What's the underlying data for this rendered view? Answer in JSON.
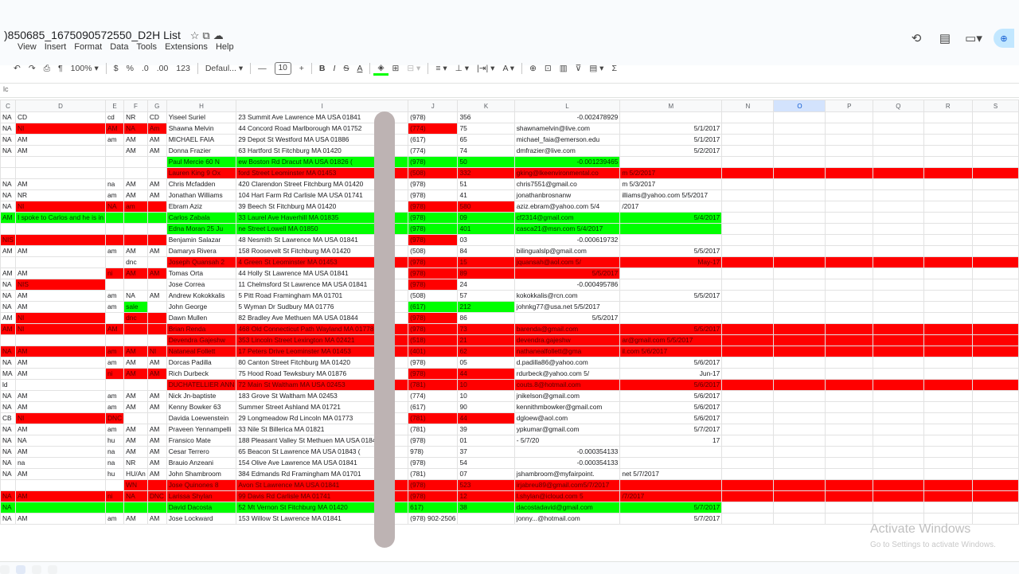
{
  "app": {
    "doc_title": ")850685_1675090572550_D2H List",
    "menu": [
      "View",
      "Insert",
      "Format",
      "Data",
      "Tools",
      "Extensions",
      "Help"
    ]
  },
  "toolbar": {
    "zoom": "100%",
    "currency": "$",
    "percent": "%",
    "dec_decrease": ".0",
    "dec_increase": ".00",
    "format_123": "123",
    "font": "Defaul...",
    "font_size": "10",
    "minus": "—",
    "plus": "+",
    "bold": "B",
    "italic": "I",
    "strike": "S",
    "text_color": "A",
    "sigma": "Σ"
  },
  "formula_bar": {
    "cell_ref": "lc"
  },
  "columns": [
    "C",
    "D",
    "E",
    "F",
    "G",
    "H",
    "I",
    "J",
    "K",
    "L",
    "M",
    "N",
    "O",
    "P",
    "Q",
    "R",
    "S"
  ],
  "selected_column": "O",
  "rows": [
    {
      "style": "",
      "cells": [
        "NA",
        "CD",
        "cd",
        "NR",
        "CD",
        "Yiseel Suriel",
        "23 Summit Ave Lawrence MA USA 01841",
        "(978)",
        "356",
        "-0.002478929",
        "",
        "",
        "",
        "",
        "",
        "",
        ""
      ],
      "num": [
        9
      ],
      "marks": {}
    },
    {
      "style": "",
      "cells": [
        "NA",
        "NI",
        "AM",
        "NA",
        "Am",
        "Shawna Melvin",
        "44 Concord Road Marlborough MA 01752",
        "(774)",
        "75",
        "shawnamelvin@live.com",
        "5/1/2017",
        "",
        "",
        "",
        "",
        "",
        ""
      ],
      "num": [
        10
      ],
      "marks": {
        "1": "r",
        "2": "r",
        "3": "r",
        "4": "r",
        "7": "r"
      }
    },
    {
      "style": "",
      "cells": [
        "NA",
        "AM",
        "am",
        "AM",
        "AM",
        "MICHAEL FAIA",
        "29 Depot St Westford MA USA 01886",
        "(617)",
        "65",
        "michael_faia@emerson.edu",
        "5/1/2017",
        "",
        "",
        "",
        "",
        "",
        ""
      ],
      "num": [
        10
      ],
      "marks": {}
    },
    {
      "style": "",
      "cells": [
        "NA",
        "AM",
        "",
        "AM",
        "AM",
        "Donna Frazier",
        "63 Hartford St Fitchburg MA 01420",
        "(774)",
        "74",
        "dmfrazier@live.com",
        "5/2/2017",
        "",
        "",
        "",
        "",
        "",
        ""
      ],
      "num": [
        10
      ],
      "marks": {}
    },
    {
      "style": "green",
      "cells": [
        "",
        "",
        "",
        "",
        "",
        "Paul Mercie 60 N",
        "ew Boston Rd Dracut MA USA 01826 (",
        "(978)",
        "50",
        "-0.001239465",
        "",
        "",
        "",
        "",
        "",
        "",
        ""
      ],
      "num": [
        9
      ],
      "marks": {},
      "span": [
        5,
        10
      ]
    },
    {
      "style": "red",
      "cells": [
        "",
        "",
        "",
        "",
        "",
        "Lauren King 9 Ox",
        "ford Street Leominster MA 01453",
        "(508)",
        "332",
        "gking@lkeenvironmental.co",
        "m 5/2/2017",
        "",
        "",
        "",
        "",
        "",
        ""
      ],
      "num": [],
      "marks": {},
      "span": [
        5,
        17
      ]
    },
    {
      "style": "",
      "cells": [
        "NA",
        "AM",
        "na",
        "AM",
        "AM",
        "Chris Mcfadden",
        "420 Clarendon Street Fitchburg MA 01420",
        "(978)",
        "51",
        "chris7551@gmail.co",
        "m 5/3/2017",
        "",
        "",
        "",
        "",
        "",
        ""
      ],
      "num": [],
      "marks": {}
    },
    {
      "style": "",
      "cells": [
        "NA",
        "NR",
        "am",
        "AM",
        "AM",
        "Jonathan Williams",
        "104 Hart Farm Rd Carlisle MA USA 01741",
        "(978)",
        "41",
        "jonathanbrosnanw",
        "illiams@yahoo.com 5/5/2017",
        "",
        "",
        "",
        "",
        "",
        ""
      ],
      "num": [],
      "marks": {}
    },
    {
      "style": "",
      "cells": [
        "NA",
        "NI",
        "NA",
        "am",
        "",
        "Ebram Aziz",
        "39 Beech St Fitchburg MA 01420",
        "(978)",
        "580",
        "aziz.ebram@yahoo.com 5/4",
        "/2017",
        "",
        "",
        "",
        "",
        "",
        ""
      ],
      "num": [],
      "marks": {
        "1": "r",
        "2": "r",
        "3": "r",
        "4": "r",
        "7": "r",
        "8": "r"
      }
    },
    {
      "style": "green",
      "cells": [
        "AM",
        "I spoke to Carlos and he is in",
        "",
        "",
        "",
        "Carlos Zabala",
        "33 Laurel Ave Haverhill MA 01835",
        "(978)",
        "09",
        "cf2314@gmail.com",
        "5/4/2017",
        "",
        "",
        "",
        "",
        "",
        ""
      ],
      "num": [
        10
      ],
      "marks": {},
      "span": [
        0,
        11
      ]
    },
    {
      "style": "green",
      "cells": [
        "",
        "",
        "",
        "",
        "",
        "Edna Moran 25 Ju",
        "ne Street Lowell MA 01850",
        "(978)",
        "401",
        "casca21@msn.com 5/4/2017",
        "",
        "",
        "",
        "",
        "",
        "",
        ""
      ],
      "num": [],
      "marks": {},
      "span": [
        5,
        11
      ]
    },
    {
      "style": "",
      "cells": [
        "NIS",
        "",
        "",
        "",
        "",
        "Benjamin Salazar",
        "48 Nesmith St Lawrence MA USA 01841",
        "(978)",
        "03",
        "-0.000619732",
        "",
        "",
        "",
        "",
        "",
        "",
        ""
      ],
      "num": [
        9
      ],
      "marks": {
        "0": "r",
        "1": "r",
        "2": "r",
        "3": "r",
        "4": "r",
        "7": "r"
      }
    },
    {
      "style": "",
      "cells": [
        "AM",
        "AM",
        "am",
        "AM",
        "AM",
        "Damarys Rivera",
        "158 Roosevelt St Fitchburg MA 01420",
        "(508)",
        "84",
        "bilingualslp@gmail.com",
        "5/5/2017",
        "",
        "",
        "",
        "",
        "",
        ""
      ],
      "num": [
        10
      ],
      "marks": {}
    },
    {
      "style": "red",
      "cells": [
        "",
        "",
        "",
        "dnc",
        "",
        "Joseph Quansah 2",
        "4 Green St Leominster MA 01453",
        "(978)",
        "15",
        "jquansah@aol.com 5/",
        "May-17",
        "",
        "",
        "",
        "",
        "",
        ""
      ],
      "num": [
        10
      ],
      "marks": {
        "0": "w",
        "1": "w",
        "2": "w",
        "3": "w",
        "4": "w"
      },
      "span": [
        5,
        17
      ]
    },
    {
      "style": "",
      "cells": [
        "AM",
        "AM",
        "ni",
        "AM",
        "AM",
        "Tomas Orta",
        "44 Holly St Lawrence MA USA 01841",
        "(978)",
        "89",
        "5/5/2017",
        "",
        "",
        "",
        "",
        "",
        "",
        ""
      ],
      "num": [
        9
      ],
      "marks": {
        "2": "r",
        "3": "r",
        "4": "r",
        "7": "r",
        "8": "r",
        "9": "r"
      }
    },
    {
      "style": "",
      "cells": [
        "NA",
        "NIS",
        "",
        "",
        "",
        "Jose Correa",
        "11 Chelmsford St Lawrence MA USA 01841",
        "(978)",
        "24",
        "-0.000495786",
        "",
        "",
        "",
        "",
        "",
        "",
        ""
      ],
      "num": [
        9
      ],
      "marks": {
        "1": "r",
        "7": "r"
      }
    },
    {
      "style": "",
      "cells": [
        "NA",
        "AM",
        "am",
        "NA",
        "AM",
        "Andrew Kokokkalis",
        "5 Pitt Road Framingham MA 01701",
        "(508)",
        "57",
        "kokokkalis@rcn.com",
        "5/5/2017",
        "",
        "",
        "",
        "",
        "",
        ""
      ],
      "num": [
        10
      ],
      "marks": {}
    },
    {
      "style": "",
      "cells": [
        "NA",
        "AM",
        "am",
        "sale",
        "",
        "John George",
        "5 Wyman Dr Sudbury MA 01776",
        "(617)",
        "212",
        "johnkg77@usa.net 5/5/2017",
        "",
        "",
        "",
        "",
        "",
        "",
        ""
      ],
      "num": [],
      "marks": {
        "3": "g",
        "7": "g",
        "8": "g"
      }
    },
    {
      "style": "",
      "cells": [
        "AM",
        "NI",
        "",
        "dnc",
        "",
        "Dawn Mullen",
        "82 Bradley Ave Methuen MA USA 01844",
        "(978)",
        "86",
        "5/5/2017",
        "",
        "",
        "",
        "",
        "",
        "",
        ""
      ],
      "num": [
        9
      ],
      "marks": {
        "1": "r",
        "3": "r",
        "4": "r",
        "7": "r"
      }
    },
    {
      "style": "red",
      "cells": [
        "AM",
        "NI",
        "AM",
        "",
        "",
        "Brian Renda",
        "468 Old Connecticut Path Wayland MA 01778",
        "(978)",
        "73",
        "barenda@gmail.com",
        "5/5/2017",
        "",
        "",
        "",
        "",
        "",
        ""
      ],
      "num": [
        10
      ],
      "marks": {},
      "span": [
        0,
        17
      ]
    },
    {
      "style": "red",
      "cells": [
        "",
        "",
        "",
        "",
        "",
        "Devendra Gajeshw",
        "353 Lincoln Street Lexington MA 02421",
        "(518)",
        "21",
        "devendra.gajeshw",
        "ar@gmail.com 5/5/2017",
        "",
        "",
        "",
        "",
        "",
        ""
      ],
      "num": [],
      "marks": {},
      "span": [
        5,
        17
      ]
    },
    {
      "style": "red",
      "cells": [
        "NA",
        "AM",
        "am",
        "AM",
        "NI",
        "Nataneal Follett",
        "17 Peters Drive Leominster MA 01453",
        "(401)",
        "62",
        "nathanealfollett@gma",
        "il.com 5/6/2017",
        "",
        "",
        "",
        "",
        "",
        ""
      ],
      "num": [],
      "marks": {},
      "span": [
        0,
        17
      ]
    },
    {
      "style": "",
      "cells": [
        "NA",
        "AM",
        "am",
        "AM",
        "AM",
        "Dorcas Padilla",
        "80 Canton Street Fitchburg MA 01420",
        "(978)",
        "05",
        "d.padilla86@yahoo.com",
        "5/6/2017",
        "",
        "",
        "",
        "",
        "",
        ""
      ],
      "num": [
        10
      ],
      "marks": {}
    },
    {
      "style": "",
      "cells": [
        "MA",
        "AM",
        "ni",
        "AM",
        "AM",
        "Rich Durbeck",
        "75 Hood Road Tewksbury MA 01876",
        "(978)",
        "44",
        "rdurbeck@yahoo.com 5/",
        "Jun-17",
        "",
        "",
        "",
        "",
        "",
        ""
      ],
      "num": [
        10
      ],
      "marks": {
        "2": "r",
        "3": "r",
        "4": "r",
        "7": "r",
        "8": "r"
      }
    },
    {
      "style": "red",
      "cells": [
        "ld",
        "",
        "",
        "",
        "",
        "DUCHATELLIER ANN",
        "72 Main St Waltham MA USA 02453",
        "(781)",
        "10",
        "couts.8@hotmail.com",
        "5/6/2017",
        "",
        "",
        "",
        "",
        "",
        ""
      ],
      "num": [
        10
      ],
      "marks": {
        "0": "w",
        "1": "w",
        "2": "w",
        "3": "w",
        "4": "w"
      },
      "span": [
        5,
        17
      ]
    },
    {
      "style": "",
      "cells": [
        "NA",
        "AM",
        "am",
        "AM",
        "AM",
        "Nick Jn-baptiste",
        "183 Grove St Waltham MA 02453",
        "(774)",
        "10",
        "jnikelson@gmail.com",
        "5/6/2017",
        "",
        "",
        "",
        "",
        "",
        ""
      ],
      "num": [
        10
      ],
      "marks": {}
    },
    {
      "style": "",
      "cells": [
        "NA",
        "AM",
        "am",
        "AM",
        "AM",
        "Kenny Bowker 63",
        "Summer Street Ashland MA 01721",
        "(617)",
        "90",
        "kennithmbowker@gmail.com",
        "5/6/2017",
        "",
        "",
        "",
        "",
        "",
        ""
      ],
      "num": [
        10
      ],
      "marks": {}
    },
    {
      "style": "",
      "cells": [
        "CB",
        "NI",
        "DNC",
        "",
        "",
        "Davida Loewenstein",
        "29 Longmeadow Rd Lincoln MA 01773",
        "(781)",
        "44",
        "dgloew@aol.com",
        "5/6/2017",
        "",
        "",
        "",
        "",
        "",
        ""
      ],
      "num": [
        10
      ],
      "marks": {
        "1": "r",
        "2": "r",
        "7": "r",
        "8": "r"
      }
    },
    {
      "style": "",
      "cells": [
        "NA",
        "AM",
        "am",
        "AM",
        "AM",
        "Praveen Yennampelli",
        "33 Nile St Billerica MA 01821",
        "(781)",
        "39",
        "ypkumar@gmail.com",
        "5/7/2017",
        "",
        "",
        "",
        "",
        "",
        ""
      ],
      "num": [
        10
      ],
      "marks": {}
    },
    {
      "style": "",
      "cells": [
        "NA",
        "NA",
        "hu",
        "AM",
        "AM",
        "Fransico Mate",
        "188 Pleasant Valley St Methuen MA USA 01844",
        "(978)",
        "01",
        "- 5/7/20",
        "17",
        "",
        "",
        "",
        "",
        "",
        ""
      ],
      "num": [
        10
      ],
      "marks": {}
    },
    {
      "style": "",
      "cells": [
        "NA",
        "AM",
        "na",
        "AM",
        "AM",
        "Cesar Terrero",
        "65 Beacon St Lawrence MA USA 01843 (",
        "978)",
        "37",
        "-0.000354133",
        "",
        "",
        "",
        "",
        "",
        "",
        ""
      ],
      "num": [
        9
      ],
      "marks": {}
    },
    {
      "style": "",
      "cells": [
        "NA",
        "na",
        "na",
        "NR",
        "AM",
        "Brauio Anzeani",
        "154 Olive Ave Lawrence MA USA 01841",
        "(978)",
        "54",
        "-0.000354133",
        "",
        "",
        "",
        "",
        "",
        "",
        ""
      ],
      "num": [
        9
      ],
      "marks": {}
    },
    {
      "style": "",
      "cells": [
        "NA",
        "AM",
        "hu",
        "HU/An",
        "AM",
        "John Shambroom",
        "384 Edmands Rd Framingham MA 01701",
        "(781)",
        "07",
        "jshambroom@myfairpoint.",
        "net 5/7/2017",
        "",
        "",
        "",
        "",
        "",
        ""
      ],
      "num": [],
      "marks": {}
    },
    {
      "style": "red",
      "cells": [
        "",
        "",
        "",
        "WN",
        "",
        "Jose Quinones 8",
        "Avon St Lawrence MA USA 01841",
        "(978)",
        "523",
        "irjabreu89@gmail.com5/7/2017",
        "",
        "",
        "",
        "",
        "",
        "",
        ""
      ],
      "num": [],
      "marks": {},
      "span": [
        3,
        17
      ]
    },
    {
      "style": "red",
      "cells": [
        "NA",
        "AM",
        "ni",
        "NA",
        "DNC",
        "Larissa Shylan",
        "99 Davis Rd Carlisle MA 01741",
        "(978)",
        "12",
        "l.shylan@icloud.com 5",
        "/7/2017",
        "",
        "",
        "",
        "",
        "",
        ""
      ],
      "num": [],
      "marks": {},
      "span": [
        0,
        17
      ]
    },
    {
      "style": "green",
      "cells": [
        "NA",
        "",
        "",
        "",
        "",
        "David Dacosta",
        "52 Mt Vernon St Fitchburg MA 01420",
        "617)",
        "38",
        "dacostadavid@gmail.com",
        "5/7/2017",
        "",
        "",
        "",
        "",
        "",
        ""
      ],
      "num": [
        10
      ],
      "marks": {},
      "span": [
        0,
        11
      ]
    },
    {
      "style": "",
      "cells": [
        "NA",
        "AM",
        "am",
        "AM",
        "AM",
        "Jose Lockward",
        "153 Willow St Lawrence MA 01841",
        "(978) 902-2506",
        "",
        "jonny...@hotmail.com",
        "5/7/2017",
        "",
        "",
        "",
        "",
        "",
        ""
      ],
      "num": [
        10
      ],
      "marks": {}
    }
  ],
  "watermark": {
    "line1": "Activate Windows",
    "line2": "Go to Settings to activate Windows."
  },
  "sheet_tabs": [
    "",
    "",
    "",
    ""
  ]
}
